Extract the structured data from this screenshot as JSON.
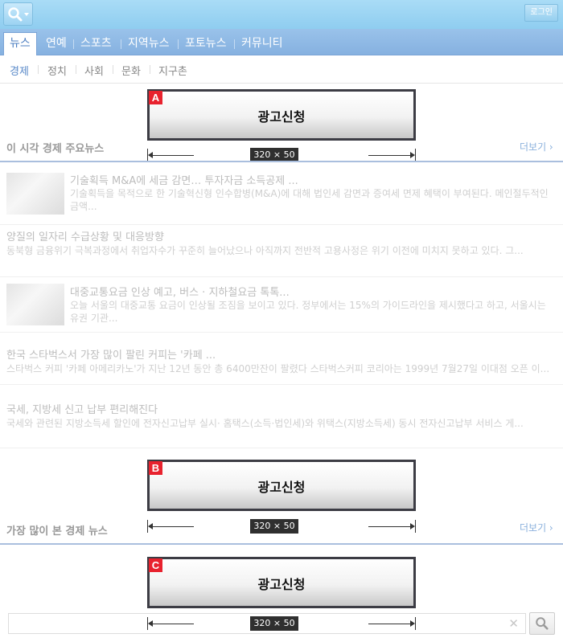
{
  "topbar": {
    "search_icon": "search-icon",
    "login_label": "로그인"
  },
  "tabs": [
    {
      "label": "뉴스",
      "active": true
    },
    {
      "label": "연예"
    },
    {
      "label": "스포츠"
    },
    {
      "label": "지역뉴스"
    },
    {
      "label": "포토뉴스"
    },
    {
      "label": "커뮤니티"
    }
  ],
  "subtabs": [
    {
      "label": "경제",
      "active": true
    },
    {
      "label": "정치"
    },
    {
      "label": "사회"
    },
    {
      "label": "문화"
    },
    {
      "label": "지구촌"
    }
  ],
  "ads": [
    {
      "badge": "A",
      "text": "광고신청",
      "size": "320 × 50"
    },
    {
      "badge": "B",
      "text": "광고신청",
      "size": "320 × 50"
    },
    {
      "badge": "C",
      "text": "광고신청",
      "size": "320 × 50"
    }
  ],
  "sections": {
    "top": {
      "title": "이 시각 경제 주요뉴스",
      "more": "더보기 ›"
    },
    "popular": {
      "title": "가장 많이 본 경제 뉴스",
      "more": "더보기 ›"
    }
  },
  "news": [
    {
      "title": "기술획득 M&A에 세금 감면… 투자자금 소득공제 ...",
      "desc": "기술획득을 목적으로 한 기술혁신형 인수합병(M&A)에 대해 법인세 감면과 증여세 면제 혜택이 부여된다. 메인절두적인 금액...",
      "has_thumb": true
    },
    {
      "title": "양질의 일자리 수급상황 및 대응방향",
      "desc": "동북형 금융위기 극복과정에서 취업자수가 꾸준히 늘어났으나 아직까지 전반적 고용사정은 위기 이전에 미치지 못하고 있다. 그...",
      "has_thumb": false
    },
    {
      "title": "대중교통요금 인상 예고, 버스 · 지하철요금 톡톡...",
      "desc": "오늘 서울의 대중교통 요금이 인상될 조짐을 보이고 있다. 정부에서는 15%의 가이드라인을 제시했다고 하고, 서울시는 유권 기관...",
      "has_thumb": true
    },
    {
      "title": "한국 스타벅스서 가장 많이 팔린 커피는 '카페 ...",
      "desc": "스타벅스 커피 '카페 아메리카노'가 지난 12년 동안 총 6400만잔이 팔렸다 스타벅스커피 코리아는 1999년 7월27일 이대점 오픈 이...",
      "has_thumb": false
    },
    {
      "title": "국세, 지방세 신고 납부 편리해진다",
      "desc": "국세와 관련된 지방소득세 할인에 전자신고납부 실시· 홈택스(소득·법인세)와 위택스(지방소득세) 동시 전자신고납부 서비스 게...",
      "has_thumb": false
    }
  ],
  "bottom_search": {
    "value": "",
    "clear_icon": "clear-icon",
    "search_icon": "search-icon"
  }
}
